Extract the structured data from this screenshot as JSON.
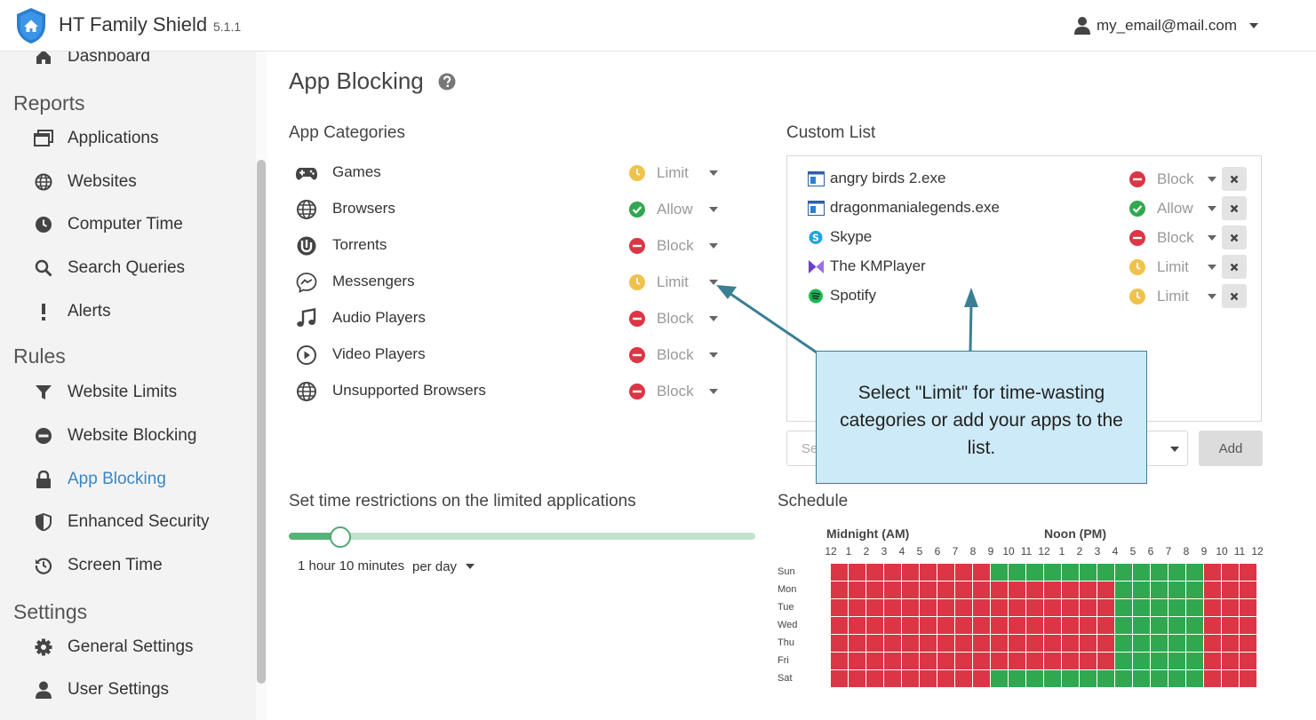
{
  "header": {
    "title": "HT Family Shield",
    "version": "5.1.1",
    "user_email": "my_email@mail.com"
  },
  "sidebar": {
    "partial_item": "Dashboard",
    "sections": [
      {
        "title": "Reports",
        "items": [
          {
            "label": "Applications",
            "icon": "applications-icon"
          },
          {
            "label": "Websites",
            "icon": "globe-icon"
          },
          {
            "label": "Computer Time",
            "icon": "clock-icon"
          },
          {
            "label": "Search Queries",
            "icon": "search-icon"
          },
          {
            "label": "Alerts",
            "icon": "exclamation-icon"
          }
        ]
      },
      {
        "title": "Rules",
        "items": [
          {
            "label": "Website Limits",
            "icon": "filter-icon"
          },
          {
            "label": "Website Blocking",
            "icon": "block-icon"
          },
          {
            "label": "App Blocking",
            "icon": "lock-icon",
            "active": true
          },
          {
            "label": "Enhanced Security",
            "icon": "shield-icon"
          },
          {
            "label": "Screen Time",
            "icon": "history-icon"
          }
        ]
      },
      {
        "title": "Settings",
        "items": [
          {
            "label": "General Settings",
            "icon": "gear-icon"
          },
          {
            "label": "User Settings",
            "icon": "user-icon"
          }
        ]
      }
    ]
  },
  "main": {
    "title": "App Blocking",
    "categories_title": "App Categories",
    "categories": [
      {
        "label": "Games",
        "status": "Limit",
        "icon": "gamepad-icon"
      },
      {
        "label": "Browsers",
        "status": "Allow",
        "icon": "globe-icon"
      },
      {
        "label": "Torrents",
        "status": "Block",
        "icon": "utorrent-icon"
      },
      {
        "label": "Messengers",
        "status": "Limit",
        "icon": "messenger-icon"
      },
      {
        "label": "Audio Players",
        "status": "Block",
        "icon": "music-icon"
      },
      {
        "label": "Video Players",
        "status": "Block",
        "icon": "play-icon"
      },
      {
        "label": "Unsupported Browsers",
        "status": "Block",
        "icon": "globe-icon"
      }
    ],
    "custom_title": "Custom List",
    "custom_list": [
      {
        "label": "angry birds 2.exe",
        "status": "Block",
        "icon": "window-app-icon"
      },
      {
        "label": "dragonmanialegends.exe",
        "status": "Allow",
        "icon": "window-app-icon"
      },
      {
        "label": "Skype",
        "status": "Block",
        "icon": "skype-icon"
      },
      {
        "label": "The KMPlayer",
        "status": "Limit",
        "icon": "kmplayer-icon"
      },
      {
        "label": "Spotify",
        "status": "Limit",
        "icon": "spotify-icon"
      }
    ],
    "add_select_placeholder": "Se",
    "add_button": "Add",
    "callout": "Select \"Limit\" for time-wasting categories or add your apps to the list.",
    "time_title": "Set time restrictions on the limited applications",
    "slider_fraction": 0.11,
    "duration": "1 hour 10 minutes",
    "period": "per day",
    "schedule": {
      "title": "Schedule",
      "am_label": "Midnight (AM)",
      "pm_label": "Noon (PM)",
      "hour_ticks": [
        "12",
        "1",
        "2",
        "3",
        "4",
        "5",
        "6",
        "7",
        "8",
        "9",
        "10",
        "11",
        "12",
        "1",
        "2",
        "3",
        "4",
        "5",
        "6",
        "7",
        "8",
        "9",
        "10",
        "11",
        "12"
      ],
      "days": [
        "Sun",
        "Mon",
        "Tue",
        "Wed",
        "Thu",
        "Fri",
        "Sat"
      ],
      "allowed_hours": [
        [
          9,
          10,
          11,
          12,
          13,
          14,
          15,
          16,
          17,
          18,
          19,
          20
        ],
        [
          16,
          17,
          18,
          19,
          20
        ],
        [
          16,
          17,
          18,
          19,
          20
        ],
        [
          16,
          17,
          18,
          19,
          20
        ],
        [
          16,
          17,
          18,
          19,
          20
        ],
        [
          16,
          17,
          18,
          19,
          20
        ],
        [
          9,
          10,
          11,
          12,
          13,
          14,
          15,
          16,
          17,
          18,
          19,
          20
        ]
      ],
      "colors": {
        "allowed": "#2fa84f",
        "blocked": "#dc3545"
      }
    }
  },
  "colors": {
    "accent": "#3a87c8",
    "limit": "#f0c24b",
    "allow": "#2fa84f",
    "block": "#dc3545"
  }
}
